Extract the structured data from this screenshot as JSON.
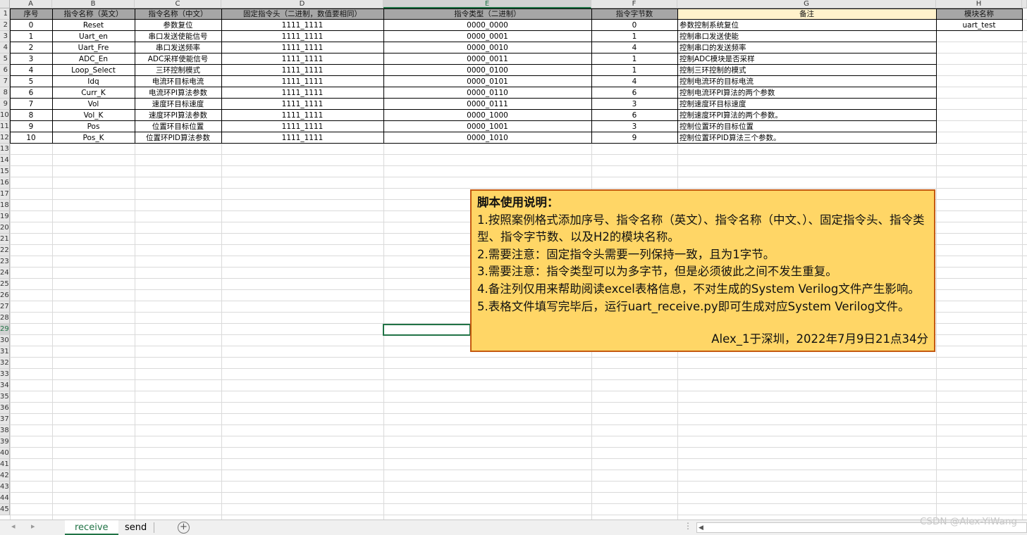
{
  "columns": [
    "A",
    "B",
    "C",
    "D",
    "E",
    "F",
    "G",
    "H"
  ],
  "active_column": "E",
  "active_row": 29,
  "row_numbers": [
    1,
    2,
    3,
    4,
    5,
    6,
    7,
    8,
    9,
    10,
    11,
    12,
    13,
    14,
    15,
    16,
    17,
    18,
    19,
    20,
    21,
    22,
    23,
    24,
    25,
    26,
    27,
    28,
    29,
    30,
    31,
    32,
    33,
    34,
    35,
    36,
    37,
    38,
    39,
    40,
    41,
    42,
    43,
    44,
    45
  ],
  "header_row": [
    "序号",
    "指令名称（英文）",
    "指令名称（中文）",
    "固定指令头（二进制，数值要相同）",
    "指令类型（二进制）",
    "指令字节数",
    "备注",
    "模块名称"
  ],
  "rows": [
    [
      "0",
      "Reset",
      "参数复位",
      "1111_1111",
      "0000_0000",
      "0",
      "参数控制系统复位",
      "uart_test"
    ],
    [
      "1",
      "Uart_en",
      "串口发送使能信号",
      "1111_1111",
      "0000_0001",
      "1",
      "控制串口发送使能",
      ""
    ],
    [
      "2",
      "Uart_Fre",
      "串口发送频率",
      "1111_1111",
      "0000_0010",
      "4",
      "控制串口的发送频率",
      ""
    ],
    [
      "3",
      "ADC_En",
      "ADC采样使能信号",
      "1111_1111",
      "0000_0011",
      "1",
      "控制ADC模块是否采样",
      ""
    ],
    [
      "4",
      "Loop_Select",
      "三环控制模式",
      "1111_1111",
      "0000_0100",
      "1",
      "控制三环控制的模式",
      ""
    ],
    [
      "5",
      "Idq",
      "电流环目标电流",
      "1111_1111",
      "0000_0101",
      "4",
      "控制电流环的目标电流",
      ""
    ],
    [
      "6",
      "Curr_K",
      "电流环PI算法参数",
      "1111_1111",
      "0000_0110",
      "6",
      "控制电流环PI算法的两个参数",
      ""
    ],
    [
      "7",
      "Vol",
      "速度环目标速度",
      "1111_1111",
      "0000_0111",
      "3",
      "控制速度环目标速度",
      ""
    ],
    [
      "8",
      "Vol_K",
      "速度环PI算法参数",
      "1111_1111",
      "0000_1000",
      "6",
      "控制速度环PI算法的两个参数。",
      ""
    ],
    [
      "9",
      "Pos",
      "位置环目标位置",
      "1111_1111",
      "0000_1001",
      "3",
      "控制位置环的目标位置",
      ""
    ],
    [
      "10",
      "Pos_K",
      "位置环PID算法参数",
      "1111_1111",
      "0000_1010",
      "9",
      "控制位置环PID算法三个参数。",
      ""
    ]
  ],
  "note": {
    "title": "脚本使用说明：",
    "lines": [
      "1.按照案例格式添加序号、指令名称（英文）、指令名称（中文、）、固定指令头、指令类型、指令字节数、以及H2的模块名称。",
      "2.需要注意：固定指令头需要一列保持一致，且为1字节。",
      "3.需要注意：指令类型可以为多字节，但是必须彼此之间不发生重复。",
      "4.备注列仅用来帮助阅读excel表格信息，不对生成的System Verilog文件产生影响。",
      "5.表格文件填写完毕后，运行uart_receive.py即可生成对应System Verilog文件。"
    ],
    "signature": "Alex_1于深圳，2022年7月9日21点34分"
  },
  "tabs": [
    "receive",
    "send"
  ],
  "active_tab": "receive",
  "watermark": "CSDN @Alex-YiWang",
  "icons": {
    "prev_sheet": "◂",
    "next_sheet": "▸",
    "add_sheet": "+",
    "more": "⋮",
    "scroll_left": "◀"
  },
  "colors": {
    "header_bg": "#a6a6a6",
    "note_bg": "#ffd666",
    "note_border": "#c55a11",
    "remark_header_bg": "#fff2cc",
    "accent": "#217346"
  }
}
